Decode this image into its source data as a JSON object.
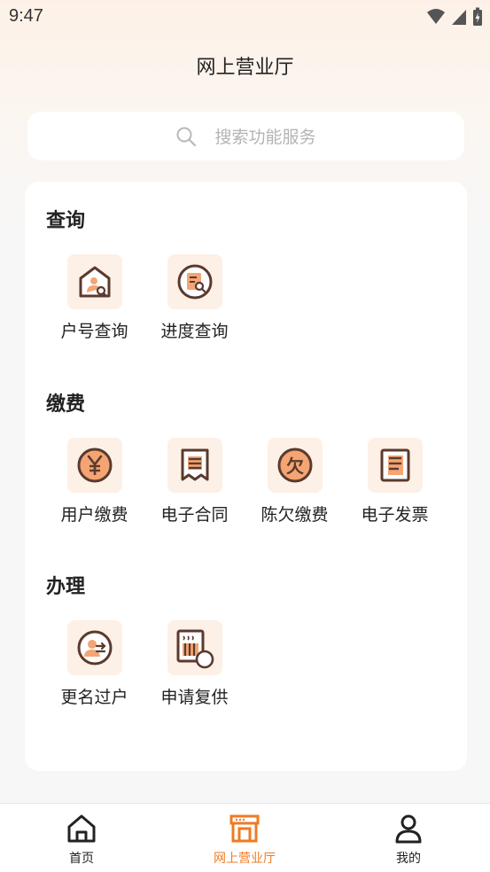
{
  "status_bar": {
    "time": "9:47"
  },
  "header": {
    "title": "网上营业厅"
  },
  "search": {
    "placeholder": "搜索功能服务"
  },
  "sections": [
    {
      "title": "查询",
      "items": [
        {
          "label": "户号查询",
          "icon": "house-user-search-icon"
        },
        {
          "label": "进度查询",
          "icon": "document-search-icon"
        }
      ]
    },
    {
      "title": "缴费",
      "items": [
        {
          "label": "用户缴费",
          "icon": "yuan-coin-icon"
        },
        {
          "label": "电子合同",
          "icon": "receipt-icon"
        },
        {
          "label": "陈欠缴费",
          "icon": "owed-payment-icon"
        },
        {
          "label": "电子发票",
          "icon": "invoice-icon"
        }
      ]
    },
    {
      "title": "办理",
      "items": [
        {
          "label": "更名过户",
          "icon": "user-transfer-icon"
        },
        {
          "label": "申请复供",
          "icon": "heater-restore-icon"
        }
      ]
    }
  ],
  "tabbar": {
    "tabs": [
      {
        "label": "首页",
        "icon": "home-icon",
        "active": false
      },
      {
        "label": "网上营业厅",
        "icon": "storefront-icon",
        "active": true
      },
      {
        "label": "我的",
        "icon": "profile-icon",
        "active": false
      }
    ]
  },
  "colors": {
    "accent": "#f07a23",
    "icon_stroke": "#5a3a2e",
    "tile_bg": "#fdf0e6",
    "icon_accent": "#f4a573"
  }
}
